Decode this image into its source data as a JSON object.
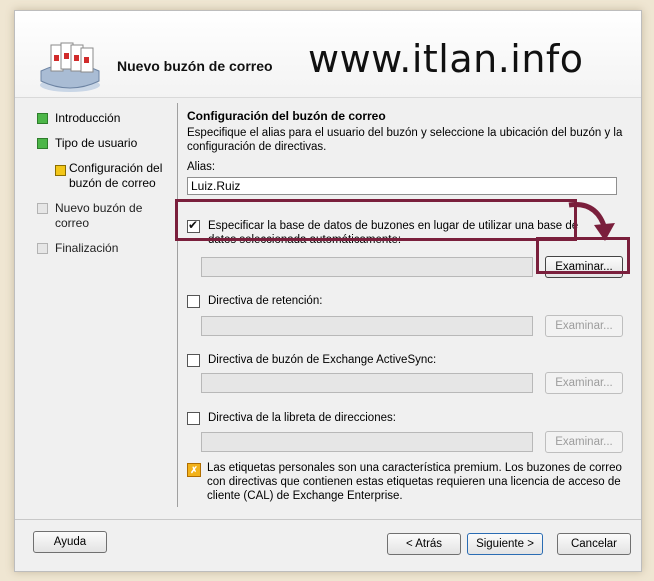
{
  "header": {
    "title": "Nuevo buzón de correo",
    "watermark": "www.itlan.info"
  },
  "sidebar": {
    "items": [
      {
        "label": "Introducción",
        "state": "done"
      },
      {
        "label": "Tipo de usuario",
        "state": "done"
      },
      {
        "label": "Configuración del buzón de correo",
        "state": "current"
      },
      {
        "label": "Nuevo buzón de correo",
        "state": "pending"
      },
      {
        "label": "Finalización",
        "state": "pending"
      }
    ]
  },
  "main": {
    "title": "Configuración del buzón de correo",
    "description": "Especifique el alias para el usuario del buzón y seleccione la ubicación del buzón y la configuración de directivas.",
    "alias_label": "Alias:",
    "alias_value": "Luiz.Ruiz",
    "options": [
      {
        "label": "Especificar la base de datos de buzones en lugar de utilizar una base de datos seleccionada automáticamente:",
        "checked": true,
        "browse_label": "Examinar...",
        "browse_enabled": true
      },
      {
        "label": "Directiva de retención:",
        "checked": false,
        "browse_label": "Examinar...",
        "browse_enabled": false
      },
      {
        "label": "Directiva de buzón de Exchange ActiveSync:",
        "checked": false,
        "browse_label": "Examinar...",
        "browse_enabled": false
      },
      {
        "label": "Directiva de la libreta de direcciones:",
        "checked": false,
        "browse_label": "Examinar...",
        "browse_enabled": false
      }
    ],
    "note": "Las etiquetas personales son una característica premium. Los buzones de correo con directivas que contienen estas etiquetas requieren una licencia de acceso de cliente (CAL) de Exchange Enterprise."
  },
  "footer": {
    "help": "Ayuda",
    "back": "< Atrás",
    "next": "Siguiente >",
    "cancel": "Cancelar"
  },
  "colors": {
    "highlight": "#7a1f3c",
    "done_step": "#4cb648",
    "current_step": "#f2c618"
  },
  "icons": {
    "header": "mailbox-stack-icon",
    "note": "warning-icon",
    "arrow": "curved-arrow-icon"
  }
}
